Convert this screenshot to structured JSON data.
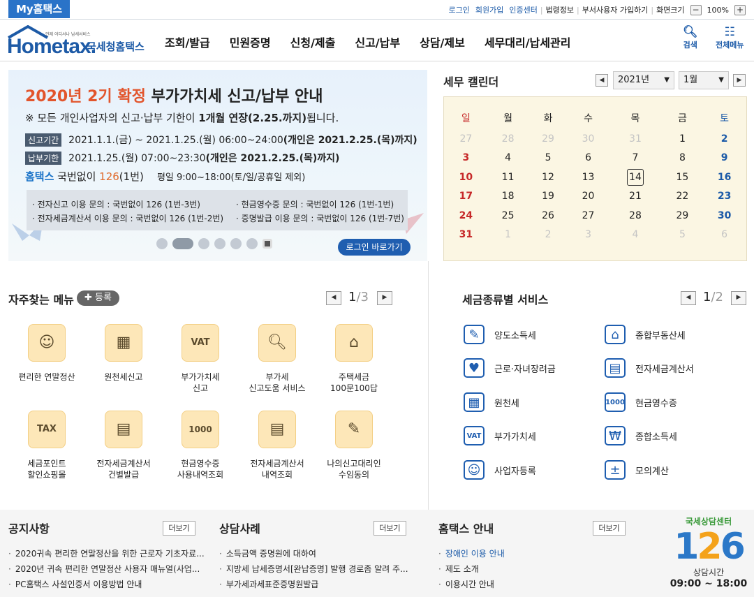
{
  "topbar": {
    "my_tab": "My홈택스",
    "links": [
      "로그인",
      "회원가입",
      "인증센터",
      "법령정보",
      "부서사용자 가입하기",
      "화면크기"
    ],
    "zoom": "100%"
  },
  "header": {
    "logo_text": "Hometax.",
    "logo_sub": "언제 어디서나 납세서비스",
    "logo_kr": "국세청홈택스",
    "nav": [
      "조회/발급",
      "민원증명",
      "신청/제출",
      "신고/납부",
      "상담/제보",
      "세무대리/납세관리"
    ],
    "search_label": "검색",
    "allmenu_label": "전체메뉴"
  },
  "banner": {
    "title_red": "2020년 2기 확정",
    "title_rest": " 부가가치세 신고/납부 안내",
    "note_pre": "※ 모든 개인사업자의 신고·납부 기한이 ",
    "note_bold": "1개월 연장(2.25.까지)",
    "note_post": "됩니다.",
    "row1_tag": "신고기간",
    "row1_text": "2021.1.1.(금) ~ 2021.1.25.(월) 06:00~24:00 ",
    "row1_bold": "(개인은 2021.2.25.(목)까지)",
    "row2_tag": "납부기한",
    "row2_text": "2021.1.25.(월) 07:00~23:30 ",
    "row2_bold": "(개인은 2021.2.25.(목)까지)",
    "phone_brand": "홈택스",
    "phone_mid": " 국번없이 ",
    "phone_num": "126",
    "phone_tail": "(1번)",
    "phone_hours": "평일 9:00~18:00(토/일/공휴일 제외)",
    "box": [
      "· 전자신고 이용 문의 : 국번없이 126 (1번-3번)",
      "· 현금영수증 문의 : 국번없이 126 (1번-1번)",
      "· 전자세금계산서 이용 문의 : 국번없이 126 (1번-2번)",
      "· 증명발급 이용 문의 : 국번없이 126 (1번-7번)"
    ],
    "login_btn": "로그인 바로가기"
  },
  "calendar": {
    "title": "세무 캘린더",
    "year": "2021년",
    "month": "1월",
    "weekdays": [
      "일",
      "월",
      "화",
      "수",
      "목",
      "금",
      "토"
    ],
    "weeks": [
      [
        "27",
        "28",
        "29",
        "30",
        "31",
        "1",
        "2"
      ],
      [
        "3",
        "4",
        "5",
        "6",
        "7",
        "8",
        "9"
      ],
      [
        "10",
        "11",
        "12",
        "13",
        "14",
        "15",
        "16"
      ],
      [
        "17",
        "18",
        "19",
        "20",
        "21",
        "22",
        "23"
      ],
      [
        "24",
        "25",
        "26",
        "27",
        "28",
        "29",
        "30"
      ],
      [
        "31",
        "1",
        "2",
        "3",
        "4",
        "5",
        "6"
      ]
    ]
  },
  "freq": {
    "title": "자주찾는 메뉴",
    "register": "등록",
    "page_cur": "1",
    "page_tot": "/3",
    "items": [
      "편리한 연말정산",
      "원천세신고",
      "부가가치세\n신고",
      "부가세\n신고도움 서비스",
      "주택세금\n100문100답",
      "세금포인트\n할인쇼핑몰",
      "전자세금계산서\n건별발급",
      "현금영수증\n사용내역조회",
      "전자세금계산서\n내역조회",
      "나의신고대리인\n수임동의"
    ]
  },
  "taxsvc": {
    "title": "세금종류별 서비스",
    "page_cur": "1",
    "page_tot": "/2",
    "items": [
      "양도소득세",
      "종합부동산세",
      "근로·자녀장려금",
      "전자세금계산서",
      "원천세",
      "현금영수증",
      "부가가치세",
      "종합소득세",
      "사업자등록",
      "모의계산"
    ]
  },
  "notice": {
    "title": "공지사항",
    "more": "더보기",
    "items": [
      "2020귀속 편리한 연말정산을 위한 근로자 기초자료...",
      "2020년 귀속 편리한 연말정산 사용자 매뉴얼(사업...",
      "PC홈택스 사설인증서 이용방법 안내"
    ]
  },
  "consult": {
    "title": "상담사례",
    "more": "더보기",
    "items": [
      "소득금액 증명원에 대하여",
      "지방세 납세증명서[완납증명] 발행 경로좀 알려 주...",
      "부가세과세표준증명원발급"
    ]
  },
  "guide": {
    "title": "홈택스 안내",
    "more": "더보기",
    "items": [
      "장애인 이용 안내",
      "제도 소개",
      "이용시간 안내"
    ]
  },
  "center": {
    "label": "국세상담센터",
    "num1": "1",
    "num2": "2",
    "num3": "6",
    "hours_label": "상담시간",
    "hours": "09:00 ~ 18:00"
  }
}
